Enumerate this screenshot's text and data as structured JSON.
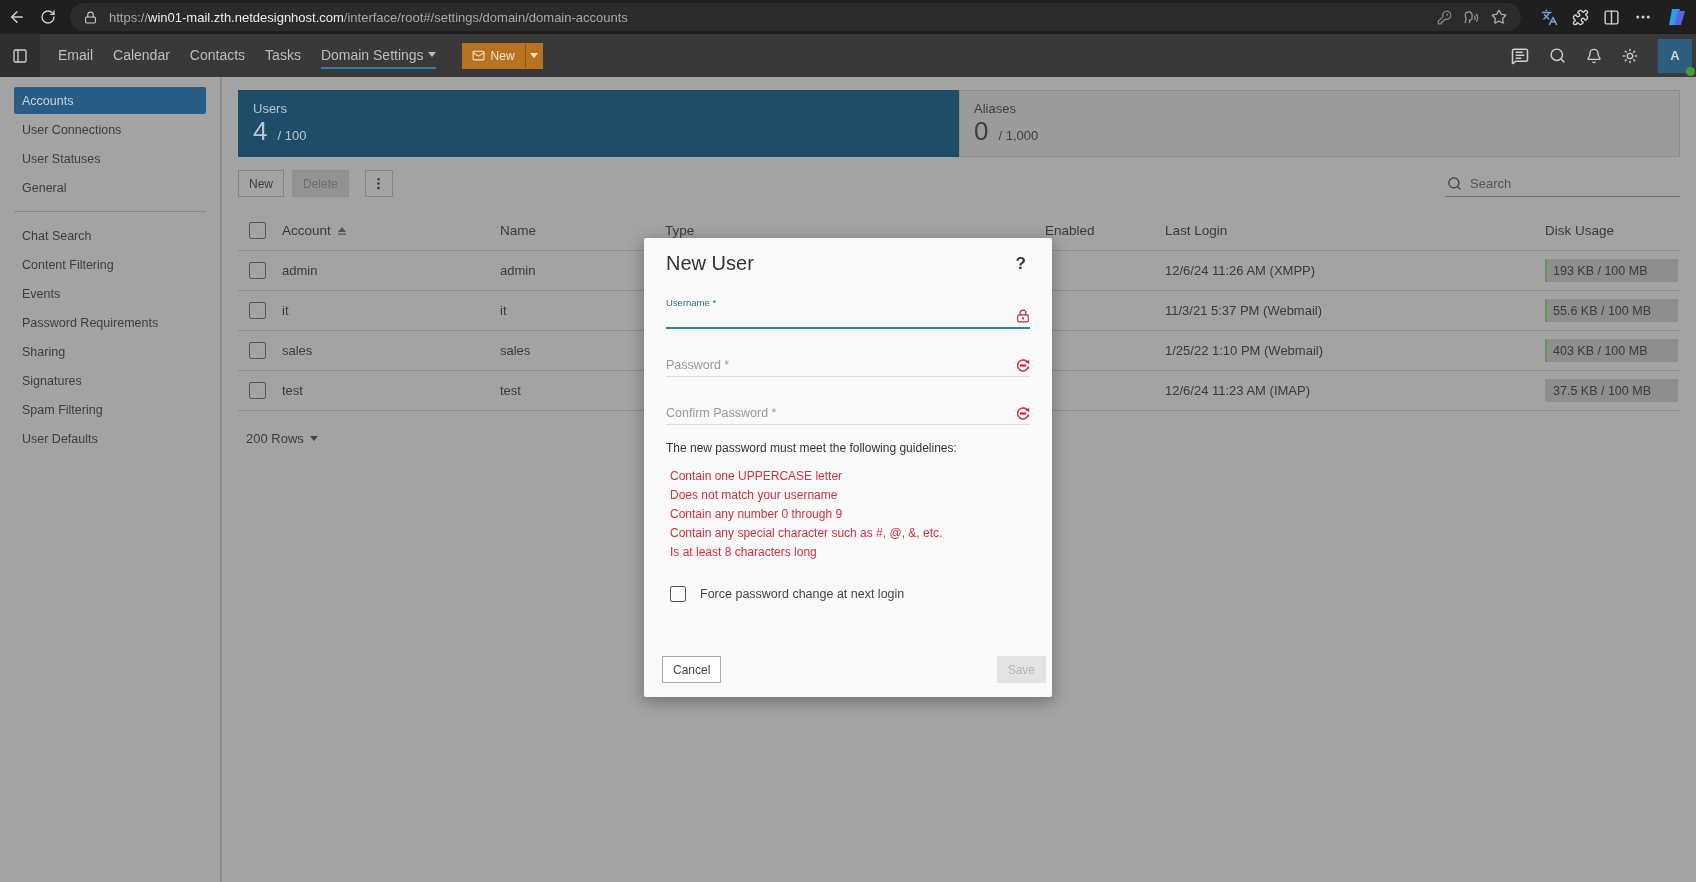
{
  "browser": {
    "url": "https://**win01-mail.zth.netdesignhost.com**/interface/root#/settings/domain/domain-accounts"
  },
  "nav": {
    "items": [
      {
        "label": "Email",
        "selected": false,
        "has_menu": false
      },
      {
        "label": "Calendar",
        "selected": false,
        "has_menu": false
      },
      {
        "label": "Contacts",
        "selected": false,
        "has_menu": false
      },
      {
        "label": "Tasks",
        "selected": false,
        "has_menu": false
      },
      {
        "label": "Domain Settings",
        "selected": true,
        "has_menu": true
      }
    ],
    "new_button": "New",
    "avatar": "A",
    "online": true
  },
  "sidebar": {
    "groups": [
      [
        {
          "label": "Accounts",
          "selected": true
        },
        {
          "label": "User Connections",
          "selected": false
        },
        {
          "label": "User Statuses",
          "selected": false
        },
        {
          "label": "General",
          "selected": false
        }
      ],
      [
        {
          "label": "Chat Search",
          "selected": false
        },
        {
          "label": "Content Filtering",
          "selected": false
        },
        {
          "label": "Events",
          "selected": false
        },
        {
          "label": "Password Requirements",
          "selected": false
        },
        {
          "label": "Sharing",
          "selected": false
        },
        {
          "label": "Signatures",
          "selected": false
        },
        {
          "label": "Spam Filtering",
          "selected": false
        },
        {
          "label": "User Defaults",
          "selected": false
        }
      ]
    ]
  },
  "stats": [
    {
      "label": "Users",
      "count": "4",
      "limit": "/ 100",
      "selected": true
    },
    {
      "label": "Aliases",
      "count": "0",
      "limit": "/ 1,000",
      "selected": false
    }
  ],
  "toolbar": {
    "buttons": [
      {
        "label": "New",
        "disabled": false
      },
      {
        "label": "Delete",
        "disabled": true
      }
    ],
    "search": {
      "placeholder": "Search"
    }
  },
  "table": {
    "select_all_checked": false,
    "columns": [
      {
        "label": "Account",
        "sorted": true
      },
      {
        "label": "Name",
        "sorted": false
      },
      {
        "label": "Type",
        "sorted": false
      },
      {
        "label": "Enabled",
        "sorted": false
      },
      {
        "label": "Last Login",
        "sorted": false
      },
      {
        "label": "Disk Usage",
        "sorted": false
      }
    ],
    "rows": [
      {
        "checked": false,
        "account": "admin",
        "name": "admin",
        "last_login": "12/6/24 11:26 AM (XMPP)",
        "disk_usage": "193 KB / 100 MB",
        "level": 0.002
      },
      {
        "checked": false,
        "account": "it",
        "name": "it",
        "last_login": "11/3/21 5:37 PM (Webmail)",
        "disk_usage": "55.6 KB / 100 MB",
        "level": 0.001
      },
      {
        "checked": false,
        "account": "sales",
        "name": "sales",
        "last_login": "1/25/22 1:10 PM (Webmail)",
        "disk_usage": "403 KB / 100 MB",
        "level": 0.004
      },
      {
        "checked": false,
        "account": "test",
        "name": "test",
        "last_login": "12/6/24 11:23 AM (IMAP)",
        "disk_usage": "37.5 KB / 100 MB"
      }
    ],
    "rows_per_page": "200 Rows"
  },
  "dialog": {
    "title": "New User",
    "help": "?",
    "fields": [
      {
        "label": "Username *",
        "focused": true,
        "kind": "user"
      },
      {
        "label": "Password *",
        "focused": false,
        "kind": "secret"
      },
      {
        "label": "Confirm Password *",
        "focused": false,
        "kind": "secret"
      }
    ],
    "guidelines_intro": "The new password must meet the following guidelines:",
    "guidelines": [
      "Contain one UPPERCASE letter",
      "Does not match your username",
      "Contain any number 0 through 9",
      "Contain any special character such as #, @, &, etc.",
      "Is at least 8 characters long"
    ],
    "force_change": {
      "label": "Force password change at next login",
      "checked": false
    },
    "buttons": [
      {
        "label": "Cancel",
        "disabled": false
      },
      {
        "label": "Save",
        "disabled": true
      }
    ]
  }
}
